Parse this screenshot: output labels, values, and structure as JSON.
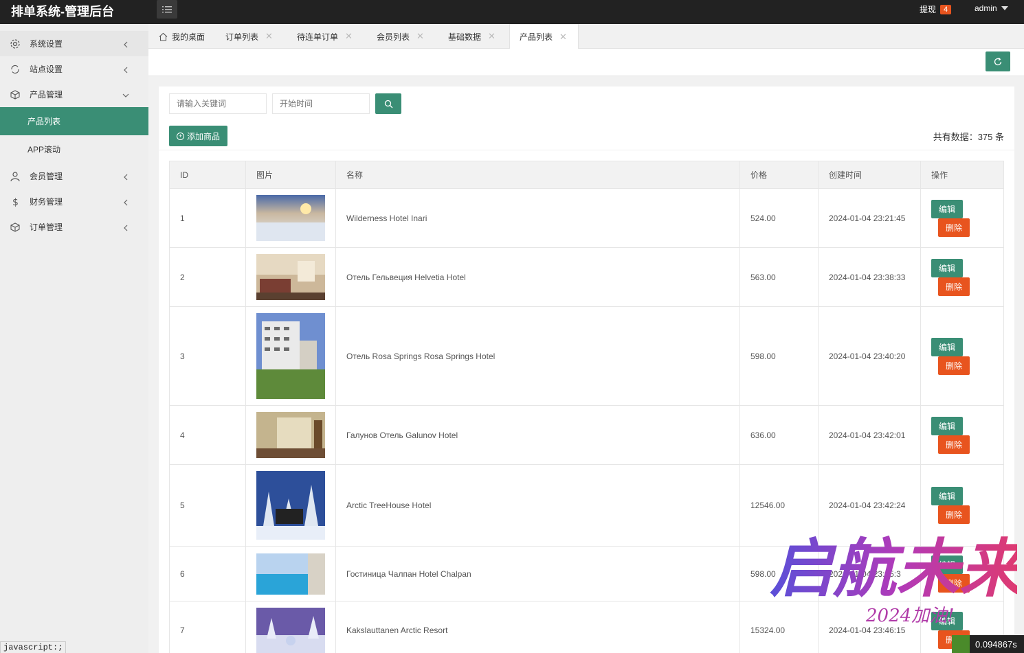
{
  "header": {
    "title": "排单系统-管理后台",
    "withdraw_label": "提现",
    "withdraw_count": "4",
    "user_name": "admin"
  },
  "sidebar": {
    "items": [
      {
        "label": "系统设置",
        "icon": "gear-icon"
      },
      {
        "label": "站点设置",
        "icon": "sync-icon"
      },
      {
        "label": "产品管理",
        "icon": "box-icon"
      },
      {
        "label": "产品列表"
      },
      {
        "label": "APP滚动"
      },
      {
        "label": "会员管理",
        "icon": "user-icon"
      },
      {
        "label": "财务管理",
        "icon": "dollar-icon"
      },
      {
        "label": "订单管理",
        "icon": "box-icon"
      }
    ]
  },
  "tabs": [
    "我的桌面",
    "订单列表",
    "待连单订单",
    "会员列表",
    "基础数据",
    "产品列表"
  ],
  "search": {
    "keyword_placeholder": "请输入关键词",
    "date_placeholder": "开始时间"
  },
  "toolbar": {
    "add_label": "添加商品",
    "total_text": "共有数据：375 条"
  },
  "table": {
    "columns": [
      "ID",
      "图片",
      "名称",
      "价格",
      "创建时间",
      "操作"
    ],
    "edit_label": "编辑",
    "delete_label": "删除",
    "rows": [
      {
        "id": "1",
        "name": "Wilderness Hotel Inari",
        "price": "524.00",
        "created": "2024-01-04 23:21:45"
      },
      {
        "id": "2",
        "name": "Отель Гельвеция Helvetia Hotel",
        "price": "563.00",
        "created": "2024-01-04 23:38:33"
      },
      {
        "id": "3",
        "name": "Отель Rosa Springs Rosa Springs Hotel",
        "price": "598.00",
        "created": "2024-01-04 23:40:20"
      },
      {
        "id": "4",
        "name": "Галунов Отель Galunov Hotel",
        "price": "636.00",
        "created": "2024-01-04 23:42:01"
      },
      {
        "id": "5",
        "name": "Arctic TreeHouse Hotel",
        "price": "12546.00",
        "created": "2024-01-04 23:42:24"
      },
      {
        "id": "6",
        "name": "Гостиница Чалпан Hotel Chalpan",
        "price": "598.00",
        "created": "2024-01-04 23:45:3"
      },
      {
        "id": "7",
        "name": "Kakslauttanen Arctic Resort",
        "price": "15324.00",
        "created": "2024-01-04 23:46:15"
      }
    ]
  },
  "statusbar": {
    "text": "javascript:;",
    "timer": "0.094867s"
  },
  "watermark": {
    "main": "启航未来",
    "sub": "2024加油!"
  },
  "colors": {
    "primary": "#3a8e75",
    "danger": "#e8541e",
    "header": "#222222"
  }
}
